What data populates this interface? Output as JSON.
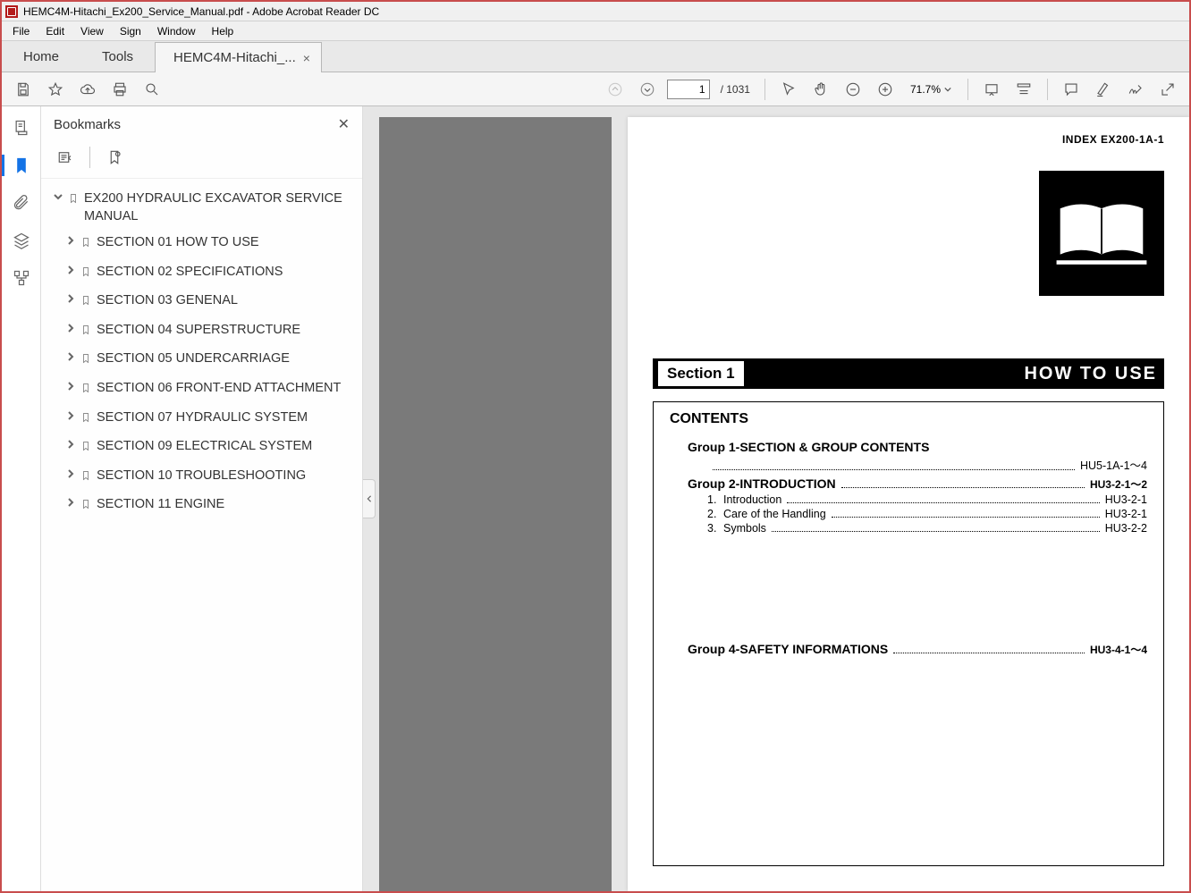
{
  "titlebar": {
    "text": "HEMC4M-Hitachi_Ex200_Service_Manual.pdf - Adobe Acrobat Reader DC"
  },
  "menubar": {
    "items": [
      "File",
      "Edit",
      "View",
      "Sign",
      "Window",
      "Help"
    ]
  },
  "tabs": {
    "home": "Home",
    "tools": "Tools",
    "doc": "HEMC4M-Hitachi_..."
  },
  "toolbar": {
    "page_current": "1",
    "page_total": "/ 1031",
    "zoom": "71.7%"
  },
  "sidepanel": {
    "title": "Bookmarks",
    "root": "EX200 HYDRAULIC EXCAVATOR SERVICE MANUAL",
    "children": [
      "SECTION 01 HOW TO USE",
      "SECTION 02 SPECIFICATIONS",
      "SECTION 03 GENENAL",
      "SECTION 04 SUPERSTRUCTURE",
      "SECTION 05 UNDERCARRIAGE",
      "SECTION 06 FRONT-END ATTACHMENT",
      "SECTION 07 HYDRAULIC SYSTEM",
      "SECTION 09 ELECTRICAL SYSTEM",
      "SECTION 10 TROUBLESHOOTING",
      "SECTION 11 ENGINE"
    ]
  },
  "page": {
    "index": "INDEX  EX200-1A-1",
    "section_badge": "Section 1",
    "section_title": "HOW  TO  USE",
    "contents_h": "CONTENTS",
    "g1": {
      "label": "Group 1-SECTION & GROUP CONTENTS",
      "ref": "HU5-1A-1～4"
    },
    "g2": {
      "label": "Group 2-INTRODUCTION",
      "ref": "HU3-2-1～2"
    },
    "g2items": [
      {
        "n": "1.",
        "t": "Introduction",
        "r": "HU3-2-1"
      },
      {
        "n": "2.",
        "t": "Care of the Handling",
        "r": "HU3-2-1"
      },
      {
        "n": "3.",
        "t": "Symbols",
        "r": "HU3-2-2"
      }
    ],
    "g4": {
      "label": "Group 4-SAFETY INFORMATIONS",
      "ref": "HU3-4-1～4"
    }
  }
}
